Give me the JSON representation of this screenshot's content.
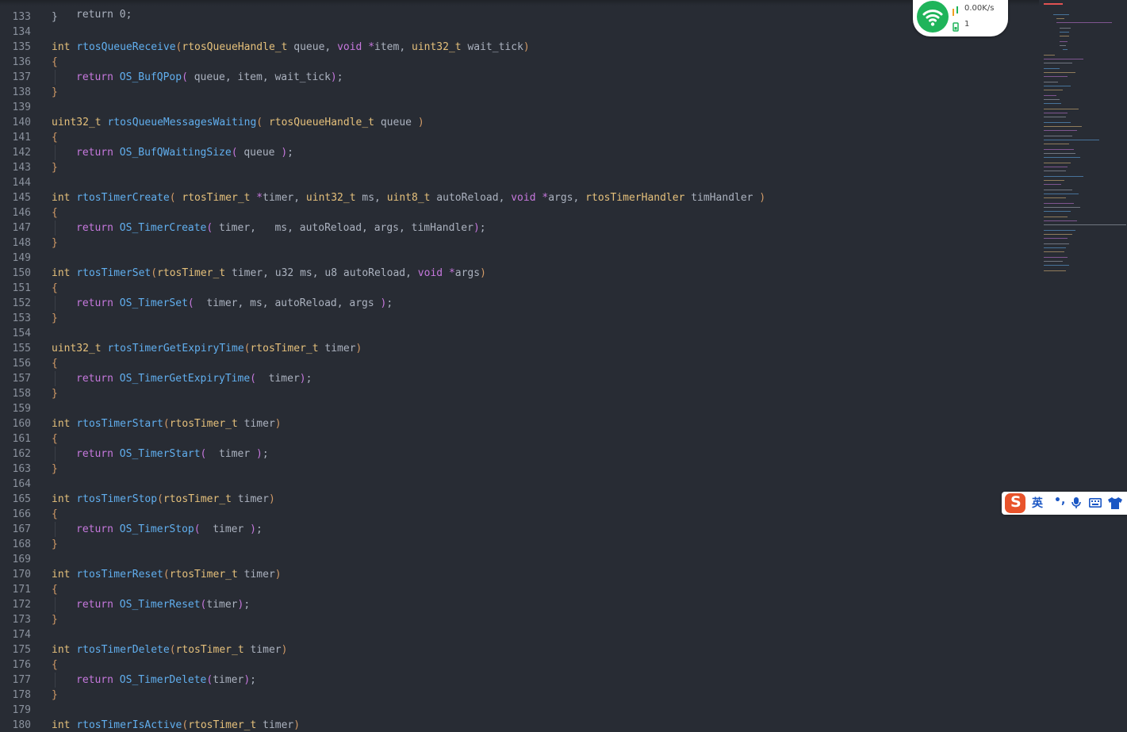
{
  "editor": {
    "partial_top_line": "return 0;",
    "lines": [
      {
        "n": "133",
        "code": [
          [
            "pn",
            "}"
          ]
        ]
      },
      {
        "n": "134",
        "code": []
      },
      {
        "n": "135",
        "code": [
          [
            "ty",
            "int"
          ],
          [
            "id",
            " "
          ],
          [
            "fn",
            "rtosQueueReceive"
          ],
          [
            "br",
            "("
          ],
          [
            "ty",
            "rtosQueueHandle_t"
          ],
          [
            "id",
            " queue, "
          ],
          [
            "kw",
            "void"
          ],
          [
            "id",
            " "
          ],
          [
            "kw",
            "*"
          ],
          [
            "id",
            "item, "
          ],
          [
            "ty",
            "uint32_t"
          ],
          [
            "id",
            " wait_tick"
          ],
          [
            "br",
            ")"
          ]
        ]
      },
      {
        "n": "136",
        "code": [
          [
            "br",
            "{"
          ]
        ]
      },
      {
        "n": "137",
        "indent": true,
        "code": [
          [
            "kw",
            "return"
          ],
          [
            "id",
            " "
          ],
          [
            "fn",
            "OS_BufQPop"
          ],
          [
            "kw",
            "("
          ],
          [
            "id",
            " queue, item, wait_tick"
          ],
          [
            "kw",
            ")"
          ],
          [
            "id",
            ";"
          ]
        ]
      },
      {
        "n": "138",
        "code": [
          [
            "br",
            "}"
          ]
        ]
      },
      {
        "n": "139",
        "code": []
      },
      {
        "n": "140",
        "code": [
          [
            "ty",
            "uint32_t"
          ],
          [
            "id",
            " "
          ],
          [
            "fn",
            "rtosQueueMessagesWaiting"
          ],
          [
            "br",
            "("
          ],
          [
            "id",
            " "
          ],
          [
            "ty",
            "rtosQueueHandle_t"
          ],
          [
            "id",
            " queue "
          ],
          [
            "br",
            ")"
          ]
        ]
      },
      {
        "n": "141",
        "code": [
          [
            "br",
            "{"
          ]
        ]
      },
      {
        "n": "142",
        "indent": true,
        "code": [
          [
            "kw",
            "return"
          ],
          [
            "id",
            " "
          ],
          [
            "fn",
            "OS_BufQWaitingSize"
          ],
          [
            "kw",
            "("
          ],
          [
            "id",
            " queue "
          ],
          [
            "kw",
            ")"
          ],
          [
            "id",
            ";"
          ]
        ]
      },
      {
        "n": "143",
        "code": [
          [
            "br",
            "}"
          ]
        ]
      },
      {
        "n": "144",
        "code": []
      },
      {
        "n": "145",
        "code": [
          [
            "ty",
            "int"
          ],
          [
            "id",
            " "
          ],
          [
            "fn",
            "rtosTimerCreate"
          ],
          [
            "br",
            "("
          ],
          [
            "id",
            " "
          ],
          [
            "ty",
            "rtosTimer_t"
          ],
          [
            "id",
            " "
          ],
          [
            "kw",
            "*"
          ],
          [
            "id",
            "timer, "
          ],
          [
            "ty",
            "uint32_t"
          ],
          [
            "id",
            " ms, "
          ],
          [
            "ty",
            "uint8_t"
          ],
          [
            "id",
            " autoReload, "
          ],
          [
            "kw",
            "void"
          ],
          [
            "id",
            " "
          ],
          [
            "kw",
            "*"
          ],
          [
            "id",
            "args, "
          ],
          [
            "ty",
            "rtosTimerHandler"
          ],
          [
            "id",
            " timHandler "
          ],
          [
            "br",
            ")"
          ]
        ]
      },
      {
        "n": "146",
        "code": [
          [
            "br",
            "{"
          ]
        ]
      },
      {
        "n": "147",
        "indent": true,
        "code": [
          [
            "kw",
            "return"
          ],
          [
            "id",
            " "
          ],
          [
            "fn",
            "OS_TimerCreate"
          ],
          [
            "kw",
            "("
          ],
          [
            "id",
            " timer,   ms, autoReload, args, timHandler"
          ],
          [
            "kw",
            ")"
          ],
          [
            "id",
            ";"
          ]
        ]
      },
      {
        "n": "148",
        "code": [
          [
            "br",
            "}"
          ]
        ]
      },
      {
        "n": "149",
        "code": []
      },
      {
        "n": "150",
        "code": [
          [
            "ty",
            "int"
          ],
          [
            "id",
            " "
          ],
          [
            "fn",
            "rtosTimerSet"
          ],
          [
            "br",
            "("
          ],
          [
            "ty",
            "rtosTimer_t"
          ],
          [
            "id",
            " timer, u32 ms, u8 autoReload, "
          ],
          [
            "kw",
            "void"
          ],
          [
            "id",
            " "
          ],
          [
            "kw",
            "*"
          ],
          [
            "id",
            "args"
          ],
          [
            "br",
            ")"
          ]
        ]
      },
      {
        "n": "151",
        "code": [
          [
            "br",
            "{"
          ]
        ]
      },
      {
        "n": "152",
        "indent": true,
        "code": [
          [
            "kw",
            "return"
          ],
          [
            "id",
            " "
          ],
          [
            "fn",
            "OS_TimerSet"
          ],
          [
            "kw",
            "("
          ],
          [
            "id",
            "  timer, ms, autoReload, args "
          ],
          [
            "kw",
            ")"
          ],
          [
            "id",
            ";"
          ]
        ]
      },
      {
        "n": "153",
        "code": [
          [
            "br",
            "}"
          ]
        ]
      },
      {
        "n": "154",
        "code": []
      },
      {
        "n": "155",
        "code": [
          [
            "ty",
            "uint32_t"
          ],
          [
            "id",
            " "
          ],
          [
            "fn",
            "rtosTimerGetExpiryTime"
          ],
          [
            "br",
            "("
          ],
          [
            "ty",
            "rtosTimer_t"
          ],
          [
            "id",
            " timer"
          ],
          [
            "br",
            ")"
          ]
        ]
      },
      {
        "n": "156",
        "code": [
          [
            "br",
            "{"
          ]
        ]
      },
      {
        "n": "157",
        "indent": true,
        "code": [
          [
            "kw",
            "return"
          ],
          [
            "id",
            " "
          ],
          [
            "fn",
            "OS_TimerGetExpiryTime"
          ],
          [
            "kw",
            "("
          ],
          [
            "id",
            "  timer"
          ],
          [
            "kw",
            ")"
          ],
          [
            "id",
            ";"
          ]
        ]
      },
      {
        "n": "158",
        "code": [
          [
            "br",
            "}"
          ]
        ]
      },
      {
        "n": "159",
        "code": []
      },
      {
        "n": "160",
        "code": [
          [
            "ty",
            "int"
          ],
          [
            "id",
            " "
          ],
          [
            "fn",
            "rtosTimerStart"
          ],
          [
            "br",
            "("
          ],
          [
            "ty",
            "rtosTimer_t"
          ],
          [
            "id",
            " timer"
          ],
          [
            "br",
            ")"
          ]
        ]
      },
      {
        "n": "161",
        "code": [
          [
            "br",
            "{"
          ]
        ]
      },
      {
        "n": "162",
        "indent": true,
        "code": [
          [
            "kw",
            "return"
          ],
          [
            "id",
            " "
          ],
          [
            "fn",
            "OS_TimerStart"
          ],
          [
            "kw",
            "("
          ],
          [
            "id",
            "  timer "
          ],
          [
            "kw",
            ")"
          ],
          [
            "id",
            ";"
          ]
        ]
      },
      {
        "n": "163",
        "code": [
          [
            "br",
            "}"
          ]
        ]
      },
      {
        "n": "164",
        "code": []
      },
      {
        "n": "165",
        "code": [
          [
            "ty",
            "int"
          ],
          [
            "id",
            " "
          ],
          [
            "fn",
            "rtosTimerStop"
          ],
          [
            "br",
            "("
          ],
          [
            "ty",
            "rtosTimer_t"
          ],
          [
            "id",
            " timer"
          ],
          [
            "br",
            ")"
          ]
        ]
      },
      {
        "n": "166",
        "code": [
          [
            "br",
            "{"
          ]
        ]
      },
      {
        "n": "167",
        "indent": true,
        "code": [
          [
            "kw",
            "return"
          ],
          [
            "id",
            " "
          ],
          [
            "fn",
            "OS_TimerStop"
          ],
          [
            "kw",
            "("
          ],
          [
            "id",
            "  timer "
          ],
          [
            "kw",
            ")"
          ],
          [
            "id",
            ";"
          ]
        ]
      },
      {
        "n": "168",
        "code": [
          [
            "br",
            "}"
          ]
        ]
      },
      {
        "n": "169",
        "code": []
      },
      {
        "n": "170",
        "code": [
          [
            "ty",
            "int"
          ],
          [
            "id",
            " "
          ],
          [
            "fn",
            "rtosTimerReset"
          ],
          [
            "br",
            "("
          ],
          [
            "ty",
            "rtosTimer_t"
          ],
          [
            "id",
            " timer"
          ],
          [
            "br",
            ")"
          ]
        ]
      },
      {
        "n": "171",
        "code": [
          [
            "br",
            "{"
          ]
        ]
      },
      {
        "n": "172",
        "indent": true,
        "code": [
          [
            "kw",
            "return"
          ],
          [
            "id",
            " "
          ],
          [
            "fn",
            "OS_TimerReset"
          ],
          [
            "kw",
            "("
          ],
          [
            "id",
            "timer"
          ],
          [
            "kw",
            ")"
          ],
          [
            "id",
            ";"
          ]
        ]
      },
      {
        "n": "173",
        "code": [
          [
            "br",
            "}"
          ]
        ]
      },
      {
        "n": "174",
        "code": []
      },
      {
        "n": "175",
        "code": [
          [
            "ty",
            "int"
          ],
          [
            "id",
            " "
          ],
          [
            "fn",
            "rtosTimerDelete"
          ],
          [
            "br",
            "("
          ],
          [
            "ty",
            "rtosTimer_t"
          ],
          [
            "id",
            " timer"
          ],
          [
            "br",
            ")"
          ]
        ]
      },
      {
        "n": "176",
        "code": [
          [
            "br",
            "{"
          ]
        ]
      },
      {
        "n": "177",
        "indent": true,
        "code": [
          [
            "kw",
            "return"
          ],
          [
            "id",
            " "
          ],
          [
            "fn",
            "OS_TimerDelete"
          ],
          [
            "kw",
            "("
          ],
          [
            "id",
            "timer"
          ],
          [
            "kw",
            ")"
          ],
          [
            "id",
            ";"
          ]
        ]
      },
      {
        "n": "178",
        "code": [
          [
            "br",
            "}"
          ]
        ]
      },
      {
        "n": "179",
        "code": []
      },
      {
        "n": "180",
        "code": [
          [
            "ty",
            "int"
          ],
          [
            "id",
            " "
          ],
          [
            "fn",
            "rtosTimerIsActive"
          ],
          [
            "br",
            "("
          ],
          [
            "ty",
            "rtosTimer_t"
          ],
          [
            "id",
            " timer"
          ],
          [
            "br",
            ")"
          ]
        ]
      }
    ]
  },
  "network_widget": {
    "speed": "0.00K/s",
    "connections": "1",
    "status_color": "#1fb45a",
    "icons": [
      "wifi-icon",
      "traffic-arrows-icon",
      "phone-icon"
    ]
  },
  "ime_toolbar": {
    "logo": "S",
    "language": "英",
    "punctuation": "•,",
    "icons": [
      "sogou-logo-icon",
      "punctuation-icon",
      "microphone-icon",
      "keyboard-icon",
      "skin-shirt-icon"
    ],
    "accent_color": "#e8532b"
  },
  "theme": {
    "background": "#282c34",
    "keyword": "#c678dd",
    "type": "#e5c07b",
    "function": "#61afef",
    "bracket": "#d19a66",
    "text": "#abb2bf",
    "line_number": "#8a919d"
  }
}
